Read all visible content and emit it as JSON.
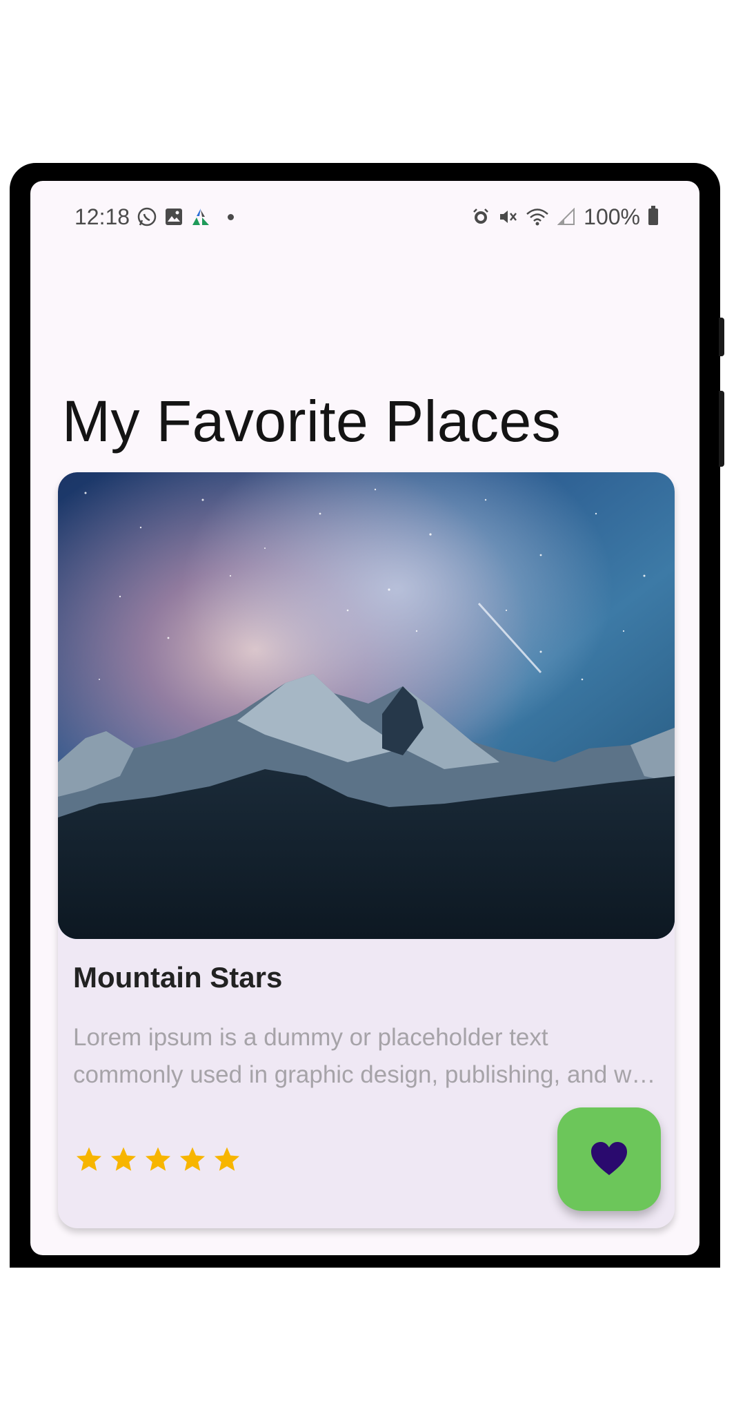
{
  "status_bar": {
    "time": "12:18",
    "battery_text": "100%",
    "left_icons": [
      "whatsapp-icon",
      "gallery-icon",
      "app-icon",
      "notification-dot-icon"
    ],
    "right_icons": [
      "alarm-icon",
      "mute-icon",
      "wifi-icon",
      "signal-icon",
      "battery-icon"
    ]
  },
  "page": {
    "title": "My Favorite Places"
  },
  "card": {
    "image_alt_name": "mountain-stars-image",
    "title": "Mountain Stars",
    "description": "Lorem ipsum is a dummy or placeholder text commonly used in graphic design, publishing, and web development to fill empty spaces in a layout.",
    "rating": 5,
    "rating_max": 5,
    "favorite_icon": "heart-icon"
  },
  "colors": {
    "screen_background": "#fcf7fc",
    "card_background": "#efe8f4",
    "star": "#f7b500",
    "favorite_button": "#6cc65a",
    "heart": "#2a0a6e"
  }
}
